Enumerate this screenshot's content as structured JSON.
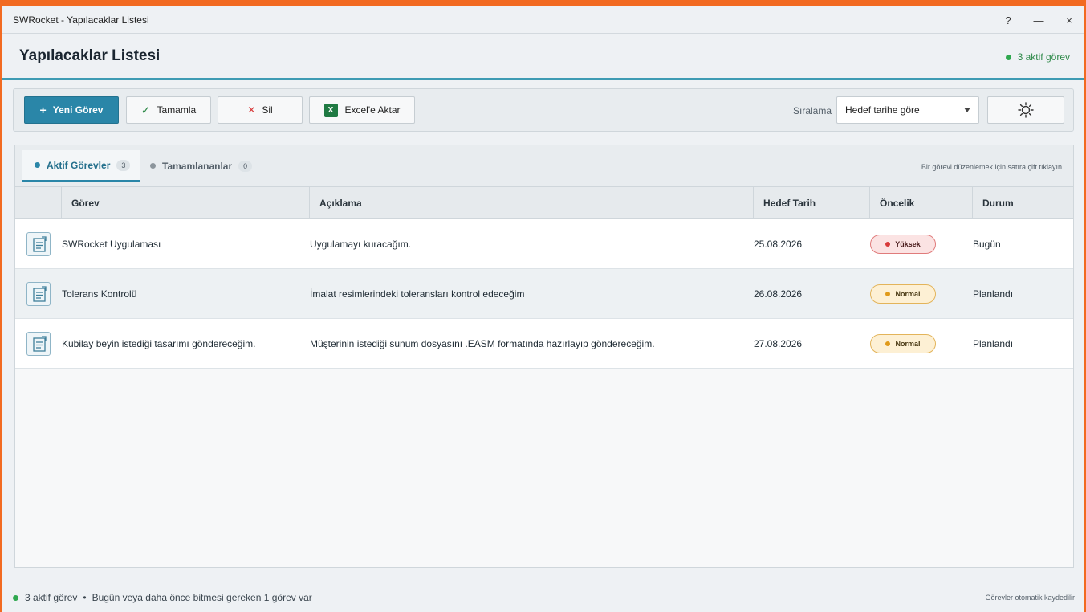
{
  "window": {
    "title": "SWRocket - Yapılacaklar Listesi",
    "help_label": "?",
    "minimize_label": "—",
    "close_label": "×"
  },
  "header": {
    "title": "Yapılacaklar Listesi",
    "active_count": "3 aktif görev"
  },
  "toolbar": {
    "new_task": "Yeni Görev",
    "complete": "Tamamla",
    "delete": "Sil",
    "export": "Excel'e Aktar",
    "sort_label": "Sıralama",
    "sort_value": "Hedef tarihe göre"
  },
  "tabs": {
    "active": {
      "label": "Aktif Görevler",
      "count": "3"
    },
    "completed": {
      "label": "Tamamlananlar",
      "count": "0"
    },
    "hint": "Bir görevi düzenlemek için satıra çift tıklayın"
  },
  "table": {
    "columns": [
      "Görev",
      "Açıklama",
      "Hedef Tarih",
      "Öncelik",
      "Durum"
    ],
    "rows": [
      {
        "task": "SWRocket Uygulaması",
        "description": "Uygulamayı kuracağım.",
        "due": "25.08.2026",
        "priority": "Yüksek",
        "status": "Bugün"
      },
      {
        "task": "Tolerans Kontrolü",
        "description": "İmalat resimlerindeki toleransları kontrol edeceğim",
        "due": "26.08.2026",
        "priority": "Normal",
        "status": "Planlandı"
      },
      {
        "task": "Kubilay beyin istediği tasarımı göndereceğim.",
        "description": "Müşterinin istediği sunum dosyasını .EASM formatında hazırlayıp göndereceğim.",
        "due": "27.08.2026",
        "priority": "Normal",
        "status": "Planlandı"
      }
    ]
  },
  "footer": {
    "active_count": "3 aktif görev",
    "separator": "•",
    "due_note": "Bugün veya daha önce bitmesi gereken 1 görev var",
    "autosave": "Görevler otomatik kaydedilir"
  },
  "colors": {
    "accent": "#2a86a8",
    "border": "#f26a21",
    "high": "#d83b3b",
    "normal": "#e09a1a",
    "ok": "#2fa84f"
  },
  "icons": {
    "new": "plus-icon",
    "complete": "check-icon",
    "delete": "x-icon",
    "export": "excel-icon",
    "theme": "sun-icon",
    "row": "task-document-icon"
  }
}
